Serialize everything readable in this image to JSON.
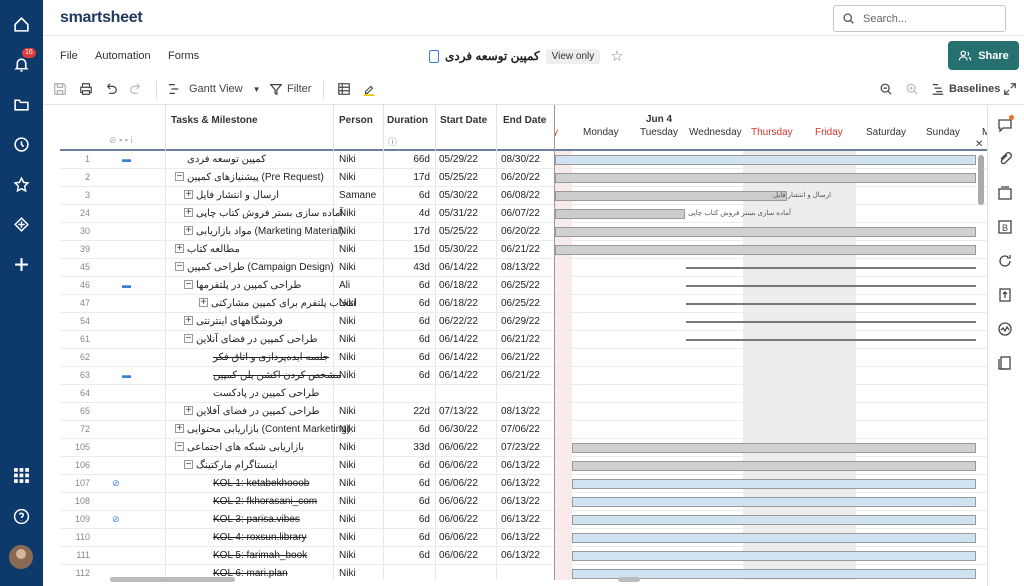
{
  "app": {
    "logo": "smartsheet",
    "search_placeholder": "Search...",
    "notif_count": "16"
  },
  "menu": {
    "file": "File",
    "automation": "Automation",
    "forms": "Forms"
  },
  "sheet": {
    "title": "کمپین توسعه فردی",
    "view_only": "View only"
  },
  "share_label": "Share",
  "toolbar": {
    "gantt_view": "Gantt View",
    "filter": "Filter",
    "baselines": "Baselines"
  },
  "columns": {
    "tasks": "Tasks & Milestone",
    "person": "Person",
    "duration": "Duration",
    "start": "Start Date",
    "end": "End Date"
  },
  "gantt": {
    "week": "Jun 4",
    "days": [
      "y",
      "Monday",
      "Tuesday",
      "Wednesday",
      "Thursday",
      "Friday",
      "Saturday",
      "Sunday",
      "M"
    ],
    "bar_label_3": "ارسال و انتشار فایل",
    "bar_label_24": "آماده سازی بستر فروش کتاب چاپی"
  },
  "colors": {
    "nav": "#0d3a6b",
    "share": "#26706f",
    "weekend": "#d9342b"
  },
  "rows": [
    {
      "n": "1",
      "task": "کمپین توسعه فردی",
      "person": "Niki",
      "dur": "66d",
      "start": "05/29/22",
      "end": "08/30/22"
    },
    {
      "n": "2",
      "task": "(Pre Request) پیشنیازهای کمپین",
      "person": "Niki",
      "dur": "17d",
      "start": "05/25/22",
      "end": "06/20/22"
    },
    {
      "n": "3",
      "task": "ارسال و انتشار فایل",
      "person": "Samane",
      "dur": "6d",
      "start": "05/30/22",
      "end": "06/08/22"
    },
    {
      "n": "24",
      "task": "آماده سازی بستر فروش کتاب چاپی",
      "person": "Niki",
      "dur": "4d",
      "start": "05/31/22",
      "end": "06/07/22"
    },
    {
      "n": "30",
      "task": "(Marketing Material) مواد بازاریابی",
      "person": "Niki",
      "dur": "17d",
      "start": "05/25/22",
      "end": "06/20/22"
    },
    {
      "n": "39",
      "task": "مطالعه کتاب",
      "person": "Niki",
      "dur": "15d",
      "start": "05/30/22",
      "end": "06/21/22"
    },
    {
      "n": "45",
      "task": "(Campaign Design) طراحی کمپین",
      "person": "Niki",
      "dur": "43d",
      "start": "06/14/22",
      "end": "08/13/22"
    },
    {
      "n": "46",
      "task": "طراحی کمپین در پلتفرمها",
      "person": "Ali",
      "dur": "6d",
      "start": "06/18/22",
      "end": "06/25/22"
    },
    {
      "n": "47",
      "task": "انتخاب پلتفرم برای کمپین مشارکتی",
      "person": "Niki",
      "dur": "6d",
      "start": "06/18/22",
      "end": "06/25/22"
    },
    {
      "n": "54",
      "task": "فروشگاههای اینترنتی",
      "person": "Niki",
      "dur": "6d",
      "start": "06/22/22",
      "end": "06/29/22"
    },
    {
      "n": "61",
      "task": "طراحی کمپین در فضای آنلاین",
      "person": "Niki",
      "dur": "6d",
      "start": "06/14/22",
      "end": "06/21/22"
    },
    {
      "n": "62",
      "task": "جلسه ایده‌پردازی و اتاق فکر",
      "person": "Niki",
      "dur": "6d",
      "start": "06/14/22",
      "end": "06/21/22"
    },
    {
      "n": "63",
      "task": "مشخص کردن اکشن پلن کمپین",
      "person": "Niki",
      "dur": "6d",
      "start": "06/14/22",
      "end": "06/21/22"
    },
    {
      "n": "64",
      "task": "طراحی کمپین در پادکست",
      "person": "",
      "dur": "",
      "start": "",
      "end": ""
    },
    {
      "n": "65",
      "task": "طراحی کمپین در فضای آفلاین",
      "person": "Niki",
      "dur": "22d",
      "start": "07/13/22",
      "end": "08/13/22"
    },
    {
      "n": "72",
      "task": "(Content Marketing) بازاریابی محتوایی",
      "person": "Niki",
      "dur": "6d",
      "start": "06/30/22",
      "end": "07/06/22"
    },
    {
      "n": "105",
      "task": "بازاریابی شبکه های اجتماعی",
      "person": "Niki",
      "dur": "33d",
      "start": "06/06/22",
      "end": "07/23/22"
    },
    {
      "n": "106",
      "task": "اینستاگرام مارکتینگ",
      "person": "Niki",
      "dur": "6d",
      "start": "06/06/22",
      "end": "06/13/22"
    },
    {
      "n": "107",
      "task": "KOL 1: ketabekhooob",
      "person": "Niki",
      "dur": "6d",
      "start": "06/06/22",
      "end": "06/13/22"
    },
    {
      "n": "108",
      "task": "KOL 2: fkhorasani_com",
      "person": "Niki",
      "dur": "6d",
      "start": "06/06/22",
      "end": "06/13/22"
    },
    {
      "n": "109",
      "task": "KOL 3: parisa.vibes",
      "person": "Niki",
      "dur": "6d",
      "start": "06/06/22",
      "end": "06/13/22"
    },
    {
      "n": "110",
      "task": "KOL 4: roxsun.library",
      "person": "Niki",
      "dur": "6d",
      "start": "06/06/22",
      "end": "06/13/22"
    },
    {
      "n": "111",
      "task": "KOL 5: farimah_book",
      "person": "Niki",
      "dur": "6d",
      "start": "06/06/22",
      "end": "06/13/22"
    },
    {
      "n": "112",
      "task": "KOL 6: mari.plan",
      "person": "Niki",
      "dur": "",
      "start": "",
      "end": ""
    }
  ]
}
